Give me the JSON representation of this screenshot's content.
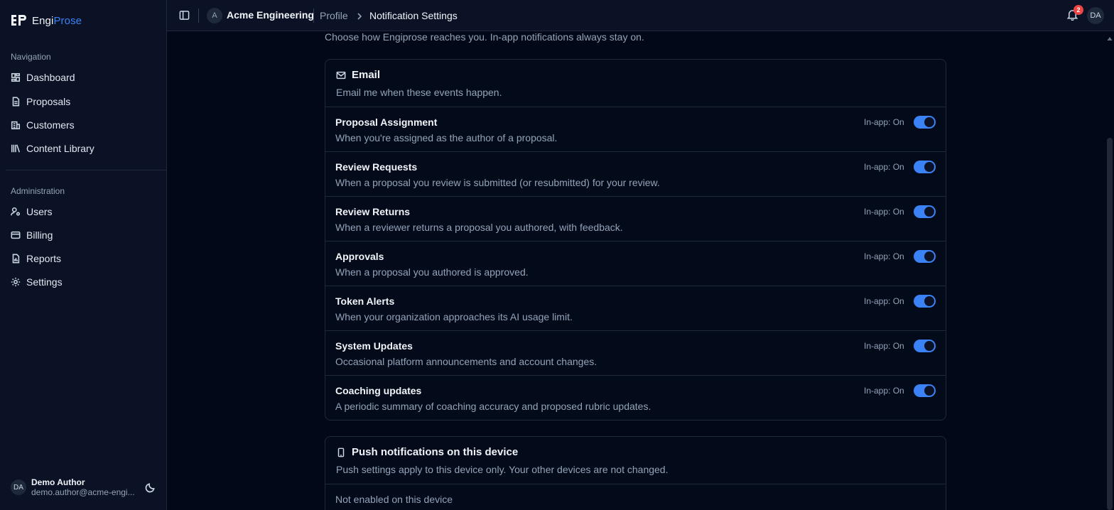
{
  "brand": {
    "name_first": "Engi",
    "name_second": "Prose"
  },
  "sidebar": {
    "nav_title": "Navigation",
    "nav_items": [
      {
        "label": "Dashboard",
        "icon": "dashboard-icon"
      },
      {
        "label": "Proposals",
        "icon": "document-icon"
      },
      {
        "label": "Customers",
        "icon": "building-icon"
      },
      {
        "label": "Content Library",
        "icon": "library-icon"
      }
    ],
    "admin_title": "Administration",
    "admin_items": [
      {
        "label": "Users",
        "icon": "user-gear-icon"
      },
      {
        "label": "Billing",
        "icon": "credit-card-icon"
      },
      {
        "label": "Reports",
        "icon": "report-icon"
      },
      {
        "label": "Settings",
        "icon": "gear-icon"
      }
    ],
    "user": {
      "initials": "DA",
      "name": "Demo Author",
      "email": "demo.author@acme-engi..."
    }
  },
  "topbar": {
    "org_initial": "A",
    "org_name": "Acme Engineering",
    "breadcrumb_parent": "Profile",
    "breadcrumb_current": "Notification Settings",
    "notification_count": "2",
    "avatar_initials": "DA"
  },
  "main": {
    "intro": "Choose how Engiprose reaches you. In-app notifications always stay on.",
    "email": {
      "title": "Email",
      "description": "Email me when these events happen.",
      "rows": [
        {
          "title": "Proposal Assignment",
          "description": "When you're assigned as the author of a proposal.",
          "inapp": "In-app: On",
          "enabled": true
        },
        {
          "title": "Review Requests",
          "description": "When a proposal you review is submitted (or resubmitted) for your review.",
          "inapp": "In-app: On",
          "enabled": true
        },
        {
          "title": "Review Returns",
          "description": "When a reviewer returns a proposal you authored, with feedback.",
          "inapp": "In-app: On",
          "enabled": true
        },
        {
          "title": "Approvals",
          "description": "When a proposal you authored is approved.",
          "inapp": "In-app: On",
          "enabled": true
        },
        {
          "title": "Token Alerts",
          "description": "When your organization approaches its AI usage limit.",
          "inapp": "In-app: On",
          "enabled": true
        },
        {
          "title": "System Updates",
          "description": "Occasional platform announcements and account changes.",
          "inapp": "In-app: On",
          "enabled": true
        },
        {
          "title": "Coaching updates",
          "description": "A periodic summary of coaching accuracy and proposed rubric updates.",
          "inapp": "In-app: On",
          "enabled": true
        }
      ]
    },
    "push": {
      "title": "Push notifications on this device",
      "description": "Push settings apply to this device only. Your other devices are not changed.",
      "status": "Not enabled on this device"
    }
  },
  "colors": {
    "accent": "#3b82f6",
    "background": "#020817",
    "badge": "#ef4444"
  }
}
